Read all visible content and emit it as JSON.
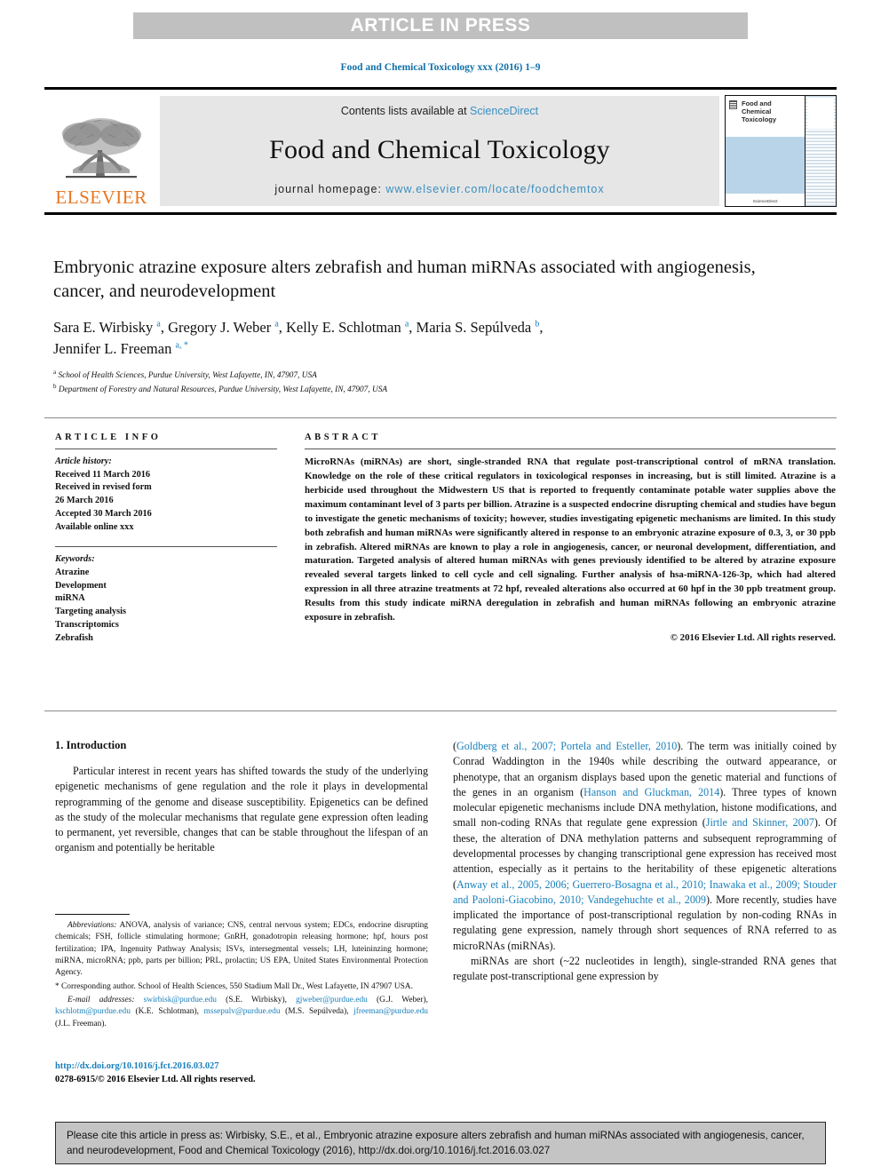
{
  "banner": {
    "text": "ARTICLE IN PRESS"
  },
  "journal_ref": "Food and Chemical Toxicology xxx (2016) 1–9",
  "masthead": {
    "contents_prefix": "Contents lists available at ",
    "contents_link": "ScienceDirect",
    "journal_title": "Food and Chemical Toxicology",
    "homepage_prefix": "journal homepage: ",
    "homepage_url": "www.elsevier.com/locate/foodchemtox",
    "publisher": "ELSEVIER",
    "cover": {
      "title": "Food and Chemical Toxicology",
      "footer": "ScienceDirect"
    }
  },
  "article": {
    "title": "Embryonic atrazine exposure alters zebrafish and human miRNAs associated with angiogenesis, cancer, and neurodevelopment",
    "authors_line1": "Sara E. Wirbisky a, Gregory J. Weber a, Kelly E. Schlotman a, Maria S. Sepúlveda b,",
    "authors_line2": "Jennifer L. Freeman a, *",
    "affiliation_a": "School of Health Sciences, Purdue University, West Lafayette, IN, 47907, USA",
    "affiliation_b": "Department of Forestry and Natural Resources, Purdue University, West Lafayette, IN, 47907, USA"
  },
  "article_info": {
    "heading": "ARTICLE INFO",
    "history_label": "Article history:",
    "history": [
      "Received 11 March 2016",
      "Received in revised form",
      "26 March 2016",
      "Accepted 30 March 2016",
      "Available online xxx"
    ],
    "keywords_label": "Keywords:",
    "keywords": [
      "Atrazine",
      "Development",
      "miRNA",
      "Targeting analysis",
      "Transcriptomics",
      "Zebrafish"
    ]
  },
  "abstract": {
    "heading": "ABSTRACT",
    "body": "MicroRNAs (miRNAs) are short, single-stranded RNA that regulate post-transcriptional control of mRNA translation. Knowledge on the role of these critical regulators in toxicological responses in increasing, but is still limited. Atrazine is a herbicide used throughout the Midwestern US that is reported to frequently contaminate potable water supplies above the maximum contaminant level of 3 parts per billion. Atrazine is a suspected endocrine disrupting chemical and studies have begun to investigate the genetic mechanisms of toxicity; however, studies investigating epigenetic mechanisms are limited. In this study both zebrafish and human miRNAs were significantly altered in response to an embryonic atrazine exposure of 0.3, 3, or 30 ppb in zebrafish. Altered miRNAs are known to play a role in angiogenesis, cancer, or neuronal development, differentiation, and maturation. Targeted analysis of altered human miRNAs with genes previously identified to be altered by atrazine exposure revealed several targets linked to cell cycle and cell signaling. Further analysis of hsa-miRNA-126-3p, which had altered expression in all three atrazine treatments at 72 hpf, revealed alterations also occurred at 60 hpf in the 30 ppb treatment group. Results from this study indicate miRNA deregulation in zebrafish and human miRNAs following an embryonic atrazine exposure in zebrafish.",
    "copyright": "© 2016 Elsevier Ltd. All rights reserved."
  },
  "introduction": {
    "heading": "1. Introduction",
    "left_paragraph": "Particular interest in recent years has shifted towards the study of the underlying epigenetic mechanisms of gene regulation and the role it plays in developmental reprogramming of the genome and disease susceptibility. Epigenetics can be defined as the study of the molecular mechanisms that regulate gene expression often leading to permanent, yet reversible, changes that can be stable throughout the lifespan of an organism and potentially be heritable",
    "right_p1_a": "(",
    "right_p1_cit1": "Goldberg et al., 2007; Portela and Esteller, 2010",
    "right_p1_b": "). The term was initially coined by Conrad Waddington in the 1940s while describing the outward appearance, or phenotype, that an organism displays based upon the genetic material and functions of the genes in an organism (",
    "right_p1_cit2": "Hanson and Gluckman, 2014",
    "right_p1_c": "). Three types of known molecular epigenetic mechanisms include DNA methylation, histone modifications, and small non-coding RNAs that regulate gene expression (",
    "right_p1_cit3": "Jirtle and Skinner, 2007",
    "right_p1_d": "). Of these, the alteration of DNA methylation patterns and subsequent reprogramming of developmental processes by changing transcriptional gene expression has received most attention, especially as it pertains to the heritability of these epigenetic alterations (",
    "right_p1_cit4": "Anway et al., 2005, 2006; Guerrero-Bosagna et al., 2010; Inawaka et al., 2009; Stouder and Paoloni-Giacobino, 2010; Vandegehuchte et al., 2009",
    "right_p1_e": "). More recently, studies have implicated the importance of post-transcriptional regulation by non-coding RNAs in regulating gene expression, namely through short sequences of RNA referred to as microRNAs (miRNAs).",
    "right_p2": "miRNAs are short (~22 nucleotides in length), single-stranded RNA genes that regulate post-transcriptional gene expression by"
  },
  "footnotes": {
    "abbrev_label": "Abbreviations:",
    "abbrev_text": " ANOVA, analysis of variance; CNS, central nervous system; EDCs, endocrine disrupting chemicals; FSH, follicle stimulating hormone; GnRH, gonadotropin releasing hormone; hpf, hours post fertilization; IPA, Ingenuity Pathway Analysis; ISVs, intersegmental vessels; LH, luteininzing hormone; miRNA, microRNA; ppb, parts per billion; PRL, prolactin; US EPA, United States Environmental Protection Agency.",
    "corresponding": "* Corresponding author. School of Health Sciences, 550 Stadium Mall Dr., West Lafayette, IN 47907 USA.",
    "email_label": "E-mail addresses:",
    "emails": [
      {
        "addr": "swirbisk@purdue.edu",
        "name": " (S.E. Wirbisky), "
      },
      {
        "addr": "gjweber@purdue.edu",
        "name": " (G.J. Weber), "
      },
      {
        "addr": "kschlotm@purdue.edu",
        "name": " (K.E. Schlotman), "
      },
      {
        "addr": "mssepulv@purdue.edu",
        "name": " (M.S. Sepúlveda), "
      },
      {
        "addr": "jfreeman@purdue.edu",
        "name": " (J.L. Freeman)."
      }
    ]
  },
  "doi_block": {
    "doi_url": "http://dx.doi.org/10.1016/j.fct.2016.03.027",
    "issn_line": "0278-6915/© 2016 Elsevier Ltd. All rights reserved."
  },
  "cite_box": {
    "text": "Please cite this article in press as: Wirbisky, S.E., et al., Embryonic atrazine exposure alters zebrafish and human miRNAs associated with angiogenesis, cancer, and neurodevelopment, Food and Chemical Toxicology (2016), http://dx.doi.org/10.1016/j.fct.2016.03.027"
  },
  "colors": {
    "link_blue": "#1a80bb",
    "elsevier_orange": "#e87722",
    "banner_gray": "#c0c0c0",
    "cite_box_gray": "#c4c4c4"
  }
}
